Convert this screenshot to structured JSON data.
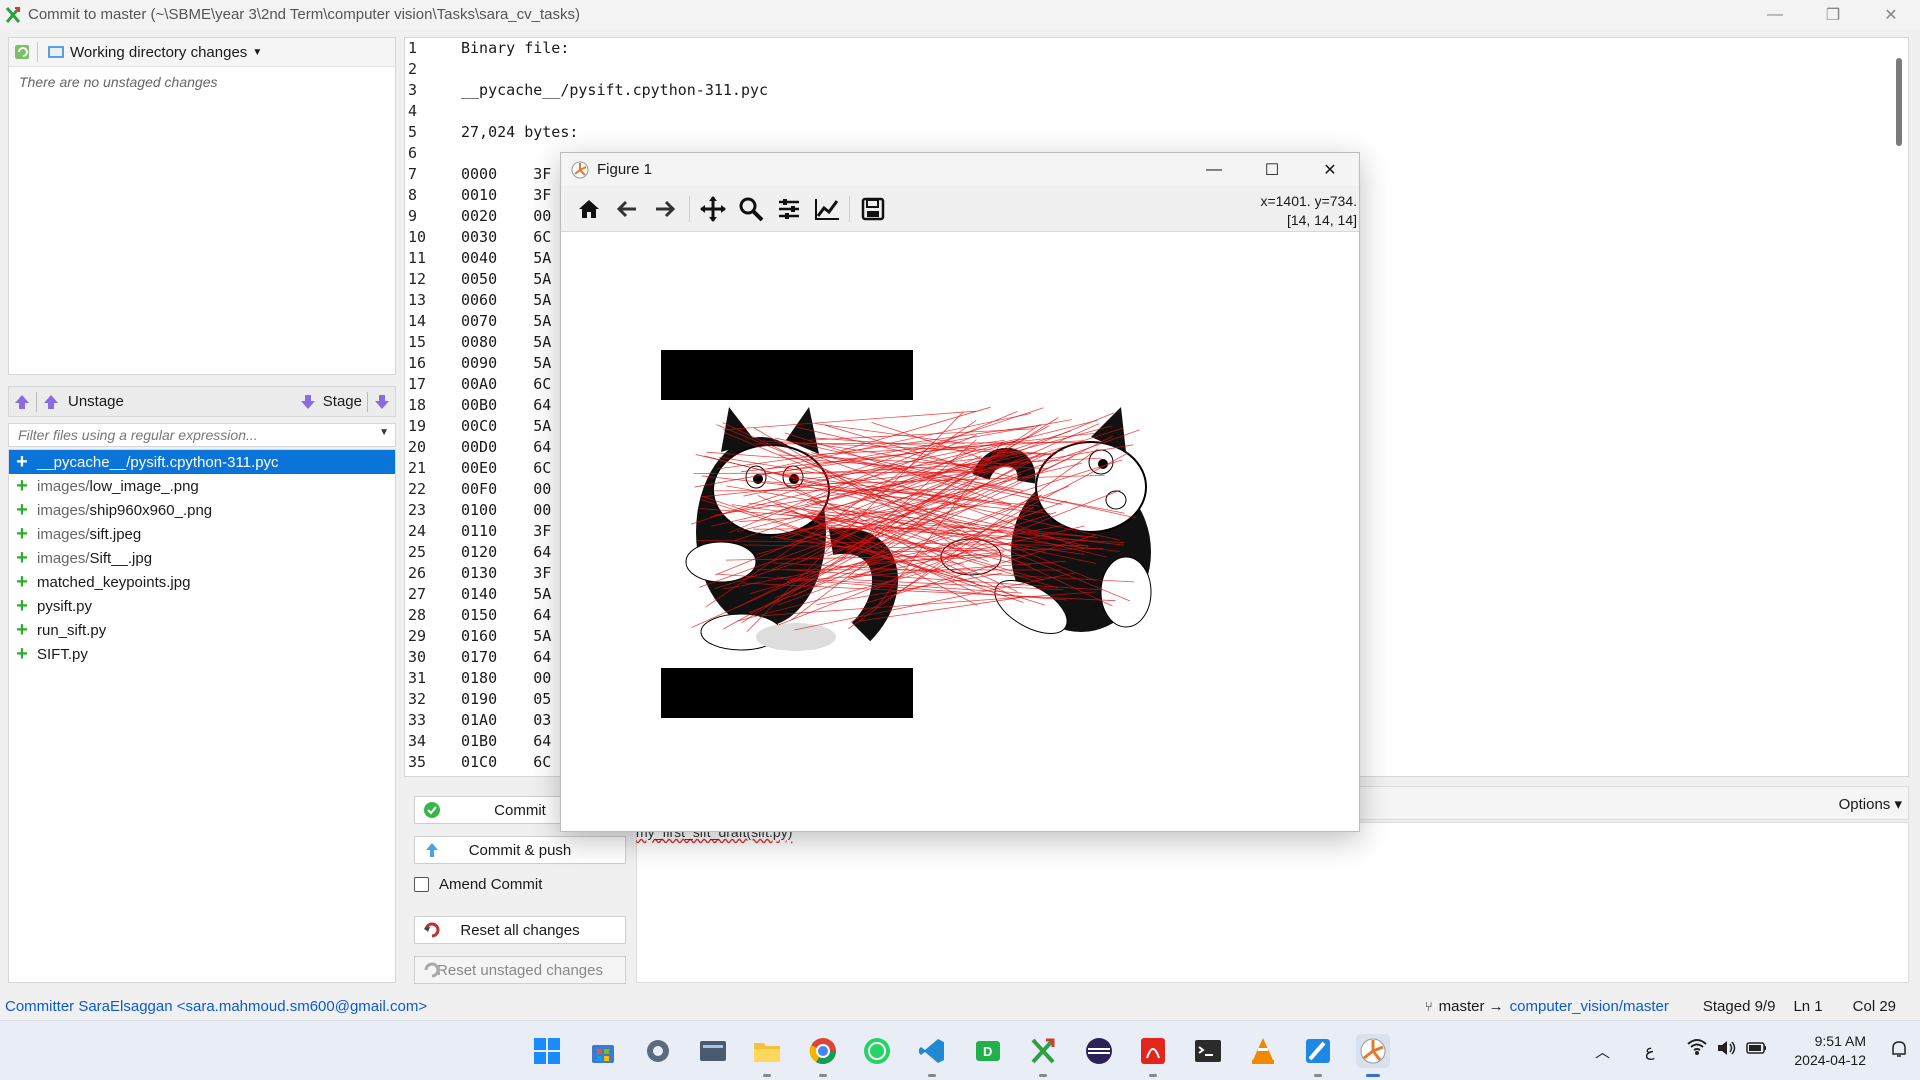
{
  "window": {
    "title": "Commit to master (~\\SBME\\year 3\\2nd Term\\computer vision\\Tasks\\sara_cv_tasks)",
    "controls": [
      "—",
      "❐",
      "✕"
    ]
  },
  "left_panel": {
    "wd_dropdown": "Working directory changes",
    "no_unstaged": "There are no unstaged changes",
    "unstage_label": "Unstage",
    "stage_label": "Stage",
    "filter_placeholder": "Filter files using a regular expression...",
    "staged_files": [
      {
        "dir": "__pycache__/",
        "name": "pysift.cpython-311.pyc",
        "selected": true
      },
      {
        "dir": "images/",
        "name": "low_image_.png"
      },
      {
        "dir": "images/",
        "name": "ship960x960_.png"
      },
      {
        "dir": "images/",
        "name": "sift.jpeg"
      },
      {
        "dir": "images/",
        "name": "Sift__.jpg"
      },
      {
        "dir": "",
        "name": "matched_keypoints.jpg"
      },
      {
        "dir": "",
        "name": "pysift.py"
      },
      {
        "dir": "",
        "name": "run_sift.py"
      },
      {
        "dir": "",
        "name": "SIFT.py"
      }
    ]
  },
  "diff": {
    "lines": [
      "Binary file:",
      "",
      "__pycache__/pysift.cpython-311.pyc",
      "",
      "27,024 bytes:",
      "",
      "0000    3F",
      "0010    3F",
      "0020    00",
      "0030    6C",
      "0040    5A",
      "0050    5A",
      "0060    5A",
      "0070    5A",
      "0080    5A",
      "0090    5A",
      "00A0    6C",
      "00B0    64",
      "00C0    5A",
      "00D0    64",
      "00E0    6C",
      "00F0    00",
      "0100    00",
      "0110    3F",
      "0120    64",
      "0130    3F",
      "0140    5A",
      "0150    64",
      "0160    5A",
      "0170    64",
      "0180    00",
      "0190    05",
      "01A0    03",
      "01B0    64",
      "01C0    6C"
    ]
  },
  "commit_area": {
    "commit_btn": "Commit",
    "commit_push_btn": "Commit & push",
    "amend": "Amend Commit",
    "reset_all": "Reset all changes",
    "reset_unstaged": "Reset unstaged changes",
    "options": "Options",
    "message": "my_first_sift_draft(sift.py)"
  },
  "statusbar": {
    "committer": "Committer SaraElsaggan <sara.mahmoud.sm600@gmail.com>",
    "branch": "master →",
    "remote": "computer_vision/master",
    "staged": "Staged  9/9",
    "ln": "Ln  1",
    "col": "Col  29"
  },
  "figure": {
    "title": "Figure 1",
    "coords_line1": "x=1401. y=734.",
    "coords_line2": "[14, 14, 14]"
  },
  "taskbar": {
    "time": "9:51 AM",
    "date": "2024-04-12",
    "lang": "ع"
  }
}
